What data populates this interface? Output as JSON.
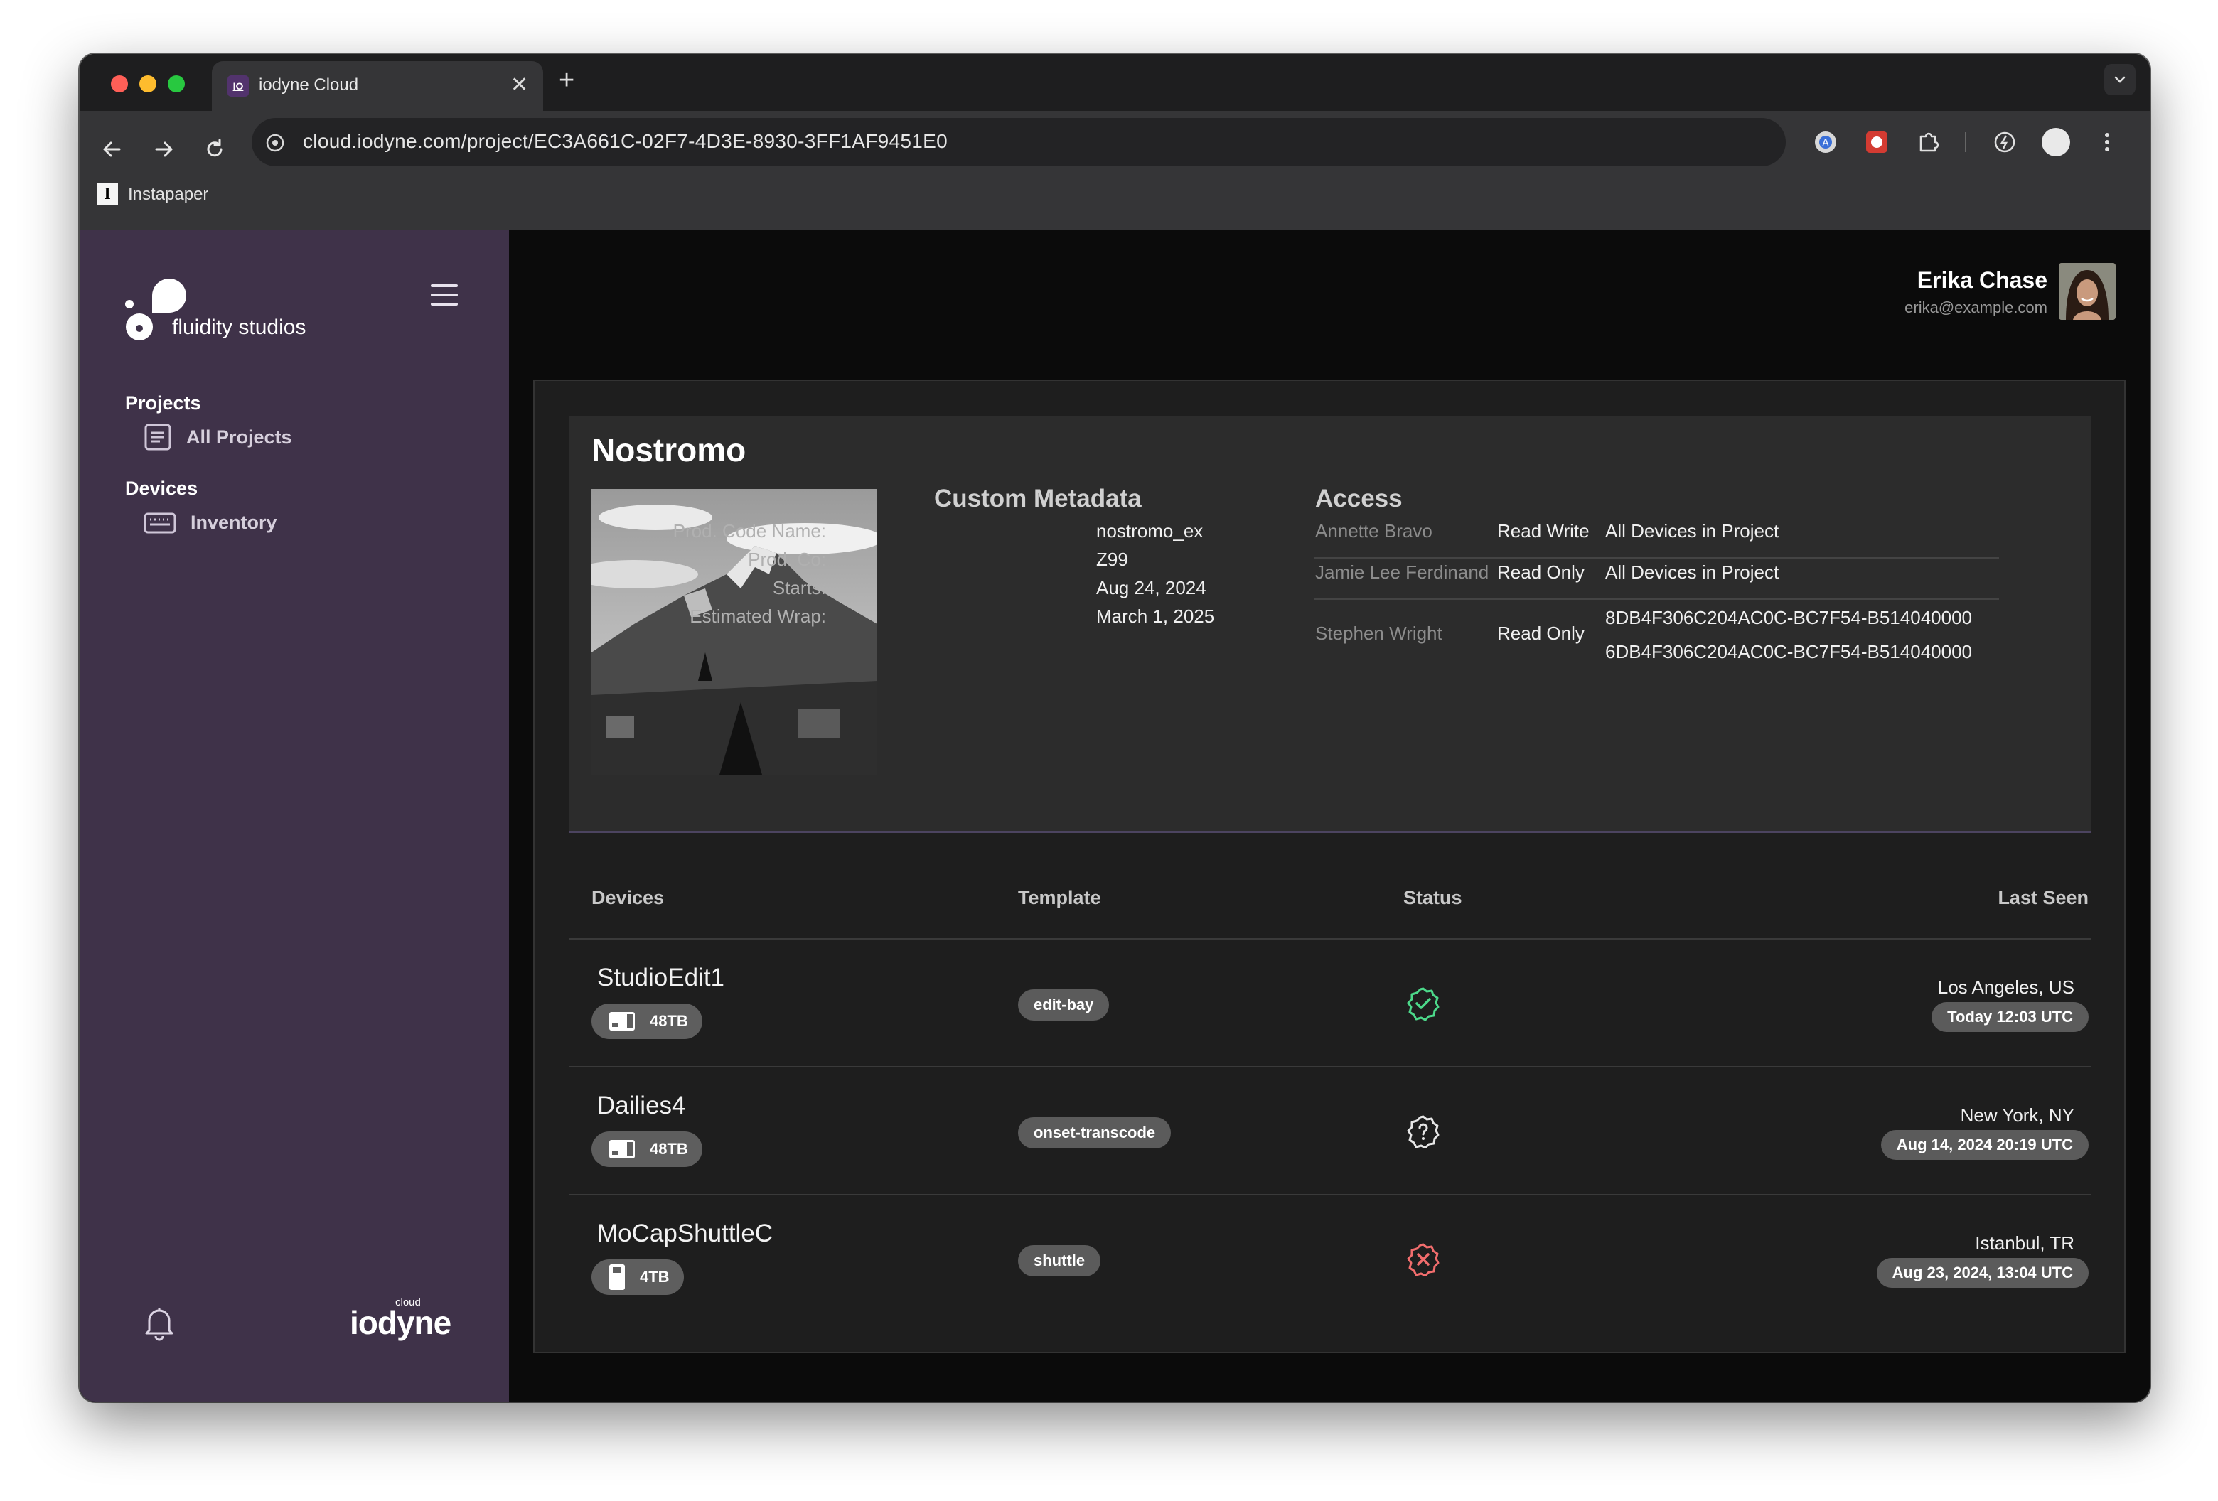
{
  "browser": {
    "tab_title": "iodyne Cloud",
    "tab_favicon": "IO",
    "url": "cloud.iodyne.com/project/EC3A661C-02F7-4D3E-8930-3FF1AF9451E0",
    "bookmark_label": "Instapaper",
    "bookmark_icon_letter": "I"
  },
  "sidebar": {
    "brand": "fluidity studios",
    "sections": [
      {
        "heading": "Projects",
        "items": [
          {
            "label": "All Projects",
            "icon": "document-list-icon"
          }
        ]
      },
      {
        "heading": "Devices",
        "items": [
          {
            "label": "Inventory",
            "icon": "keyboard-icon"
          }
        ]
      }
    ],
    "footer_brand_small": "cloud",
    "footer_brand": "iodyne"
  },
  "user": {
    "name": "Erika Chase",
    "email": "erika@example.com"
  },
  "project": {
    "title": "Nostromo",
    "metadata_title": "Custom Metadata",
    "metadata": [
      {
        "label": "Prod. Code Name:",
        "value": "nostromo_ex"
      },
      {
        "label": "Prod. Co:",
        "value": "Z99"
      },
      {
        "label": "Starts:",
        "value": "Aug 24, 2024"
      },
      {
        "label": "Estimated Wrap:",
        "value": "March 1, 2025"
      }
    ],
    "access_title": "Access",
    "access": [
      {
        "name": "Annette Bravo",
        "permission": "Read Write",
        "scope": [
          "All Devices in Project"
        ]
      },
      {
        "name": "Jamie Lee Ferdinand",
        "permission": "Read Only",
        "scope": [
          "All Devices in Project"
        ]
      },
      {
        "name": "Stephen Wright",
        "permission": "Read Only",
        "scope": [
          "8DB4F306C204AC0C-BC7F54-B514040000",
          "6DB4F306C204AC0C-BC7F54-B514040000"
        ]
      }
    ]
  },
  "devices_table": {
    "headers": {
      "devices": "Devices",
      "template": "Template",
      "status": "Status",
      "last_seen": "Last Seen"
    },
    "rows": [
      {
        "name": "StudioEdit1",
        "storage": "48TB",
        "template": "edit-bay",
        "status": "online",
        "location": "Los Angeles, US",
        "last_seen": "Today 12:03 UTC"
      },
      {
        "name": "Dailies4",
        "storage": "48TB",
        "template": "onset-transcode",
        "status": "unknown",
        "location": "New York, NY",
        "last_seen": "Aug 14, 2024 20:19 UTC"
      },
      {
        "name": "MoCapShuttleC",
        "storage": "4TB",
        "template": "shuttle",
        "status": "error",
        "location": "Istanbul, TR",
        "last_seen": "Aug 23, 2024, 13:04 UTC"
      }
    ]
  },
  "colors": {
    "sidebar": "#3f3249",
    "status_online": "#4cd98a",
    "status_unknown": "#e6e6e6",
    "status_error": "#f26d6d"
  }
}
